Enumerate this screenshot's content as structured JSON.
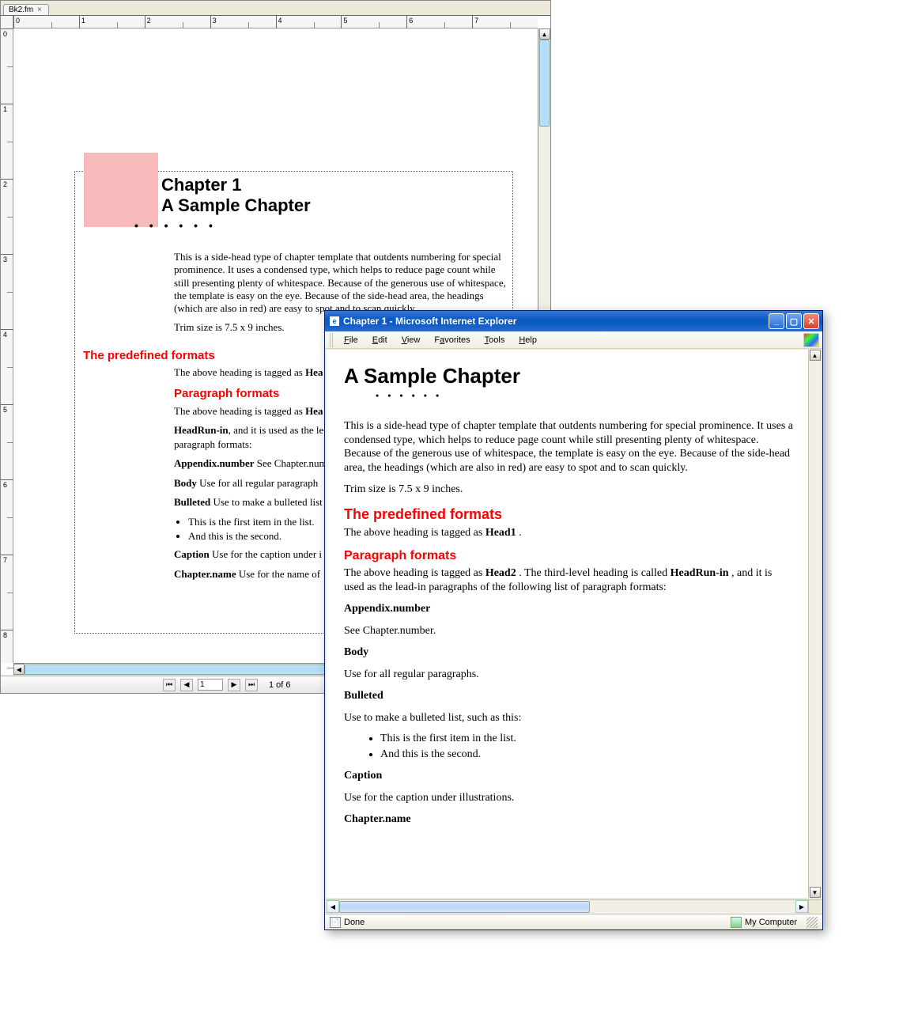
{
  "fm": {
    "tab": {
      "label": "Bk2.fm",
      "close": "×"
    },
    "ruler_h": [
      "0",
      "1",
      "2",
      "3",
      "4",
      "5",
      "6",
      "7"
    ],
    "ruler_v": [
      "0",
      "1",
      "2",
      "3",
      "4",
      "5",
      "6",
      "7",
      "8"
    ],
    "status": {
      "first": "⏮",
      "prev": "◀",
      "page_value": "1",
      "next": "▶",
      "last": "⏭",
      "label": "1 of 6"
    },
    "doc": {
      "chapter_num": "Chapter 1",
      "chapter_title": "A Sample Chapter",
      "dots": "• • • • • •",
      "para1": "This is a side-head type of chapter template that outdents numbering for special prominence. It uses a condensed type, which helps to reduce page count while still presenting plenty of whitespace. Because of the generous use of whitespace, the template is easy on the eye. Because of the side-head area, the headings (which are also in red) are easy to spot and to scan quickly.",
      "trim": "Trim size is 7.5 x 9 inches.",
      "head1": "The predefined formats",
      "head1_desc_a": "The above heading is tagged as ",
      "head1_desc_b": "Hea",
      "head2": "Paragraph formats",
      "head2_desc_a": "The above heading is tagged as ",
      "head2_desc_b": "Hea",
      "runin_b": "HeadRun-in",
      "runin_tail": ", and it is used as the le",
      "paraformats_colon": "paragraph formats:",
      "appendix_b": "Appendix.number",
      "appendix_tail": "  See Chapter.num",
      "body_b": "Body",
      "body_tail": "  Use for all regular paragraph",
      "bulleted_b": "Bulleted",
      "bulleted_tail": "  Use to make a bulleted list",
      "li1": "This is the first item in the list.",
      "li2": "And this is the second.",
      "caption_b": "Caption",
      "caption_tail": "  Use for the caption under i",
      "chaptername_b": "Chapter.name",
      "chaptername_tail": "  Use for the name of "
    }
  },
  "ie": {
    "title": "Chapter 1 - Microsoft Internet Explorer",
    "menus": [
      "File",
      "Edit",
      "View",
      "Favorites",
      "Tools",
      "Help"
    ],
    "status_done": "Done",
    "zone": "My Computer",
    "content": {
      "title": "A Sample Chapter",
      "dots": "• • • • • •",
      "para1": "This is a side-head type of chapter template that outdents numbering for special prominence. It uses a condensed type, which helps to reduce page count while still presenting plenty of whitespace. Because of the generous use of whitespace, the template is easy on the eye. Because of the side-head area, the headings (which are also in red) are easy to spot and to scan quickly.",
      "trim": "Trim size is 7.5 x 9 inches.",
      "h1": "The predefined formats",
      "h1_desc_a": "The above heading is tagged as ",
      "h1_desc_b": "Head1",
      "h1_desc_c": " .",
      "h2": "Paragraph formats",
      "h2_desc_a": "The above heading is tagged as ",
      "h2_desc_b": "Head2",
      "h2_desc_c": " . The third-level heading is called ",
      "h2_desc_d": "HeadRun-in",
      "h2_desc_e": " , and it is used as the lead-in paragraphs of the following list of paragraph formats:",
      "appendix_b": "Appendix.number",
      "appendix_p": "See Chapter.number.",
      "body_b": "Body",
      "body_p": "Use for all regular paragraphs.",
      "bulleted_b": "Bulleted",
      "bulleted_p": "Use to make a bulleted list, such as this:",
      "li1": "This is the first item in the list.",
      "li2": "And this is the second.",
      "caption_b": "Caption",
      "caption_p": "Use for the caption under illustrations.",
      "chaptername_b": "Chapter.name"
    }
  }
}
